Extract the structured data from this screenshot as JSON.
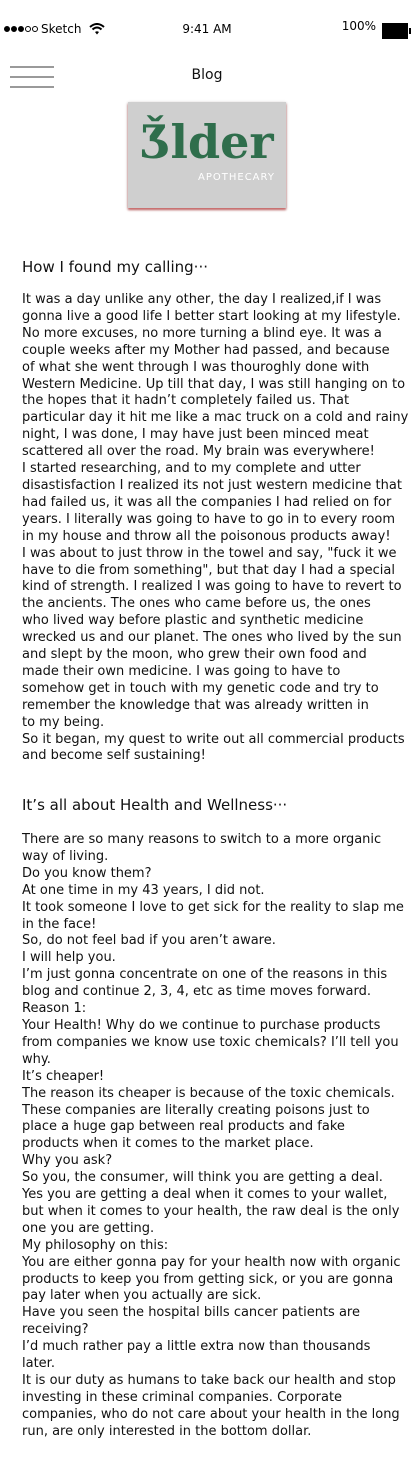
{
  "status_bar": {
    "carrier": "Sketch",
    "time": "9:41 AM",
    "battery": "100%"
  },
  "nav": {
    "title": "Blog"
  },
  "logo": {
    "main": "Ǯlder",
    "sub": "APOTHECARY",
    "color": "#2f6e4c"
  },
  "post": {
    "section1": {
      "heading": "How I found my calling···",
      "lines": [
        "It was a day unlike any other, the day I realized,if I was",
        "gonna live a good life I better start looking at my lifestyle.",
        "No more excuses, no more turning a blind eye. It was a",
        "couple weeks after my Mother had passed, and because",
        "of what she went through I was thouroghly done with",
        "Western Medicine. Up till that day, I was still hanging on to",
        "the hopes that it hadn’t completely failed us. That",
        "particular day it hit me like a mac truck on a cold and rainy",
        "night, I was done, I may have just been minced meat",
        "scattered all over the road. My brain was everywhere!",
        "I started researching, and to my complete and utter",
        "disastisfaction I realized its not just western medicine that",
        "had failed us, it was all the companies I had relied on for",
        "years. I literally was going to have to go in to every room",
        "in my house and throw all the poisonous products away!",
        "I was about to just throw in the towel and say, \"fuck it we",
        "have to die from something\", but that day I had a special",
        "kind of strength. I realized I was going to have to revert to",
        "the ancients. The ones who came before us, the ones",
        "who lived way before plastic and synthetic medicine",
        "wrecked us and our planet. The ones who lived by the sun",
        "and slept by the moon, who grew their own food and",
        "made their own medicine. I was going to have to",
        "somehow get in touch with my genetic code and try to",
        "remember the knowledge that was already written in",
        "to my being.",
        "So it began, my quest to write out all commercial products",
        "and become self sustaining!"
      ]
    },
    "section2": {
      "heading": "It’s all about Health and Wellness···",
      "lines": [
        "There are so many reasons to switch to a more organic",
        "way of living.",
        "Do you know them?",
        "At one time in my 43 years, I did not.",
        "It took someone I love to get sick for the reality to slap me",
        "in the face!",
        "So, do not feel bad if you aren’t aware.",
        "I will help you.",
        "I’m just gonna concentrate on one of the reasons in this",
        "blog and continue 2, 3, 4, etc as time moves forward.",
        "Reason 1:",
        "Your Health! Why do we continue to purchase products",
        "from companies we know use toxic chemicals? I’ll tell you",
        "why.",
        " It’s cheaper!",
        "The reason its cheaper is because of the toxic chemicals.",
        "These companies are literally creating poisons just to",
        "place a huge gap between real products and fake",
        "products when it comes to the market place.",
        " Why you ask?",
        "So you, the consumer, will think you are getting a deal.",
        "Yes you are getting a deal when it comes to your wallet,",
        "but when it comes to your health, the raw deal is the only",
        "one you are getting.",
        "My philosophy on this:",
        "You are either gonna pay for your health now with organic",
        "products to keep you from getting sick, or you are gonna",
        "pay later when you actually are sick.",
        "Have you seen the hospital bills cancer patients are",
        "receiving?",
        "I’d much rather pay a little extra now than thousands",
        "later.",
        "It is our duty as humans to take back our health and stop",
        "investing in these criminal companies. Corporate",
        "companies, who do not care about your health in the long",
        "run, are only interested in the bottom dollar."
      ]
    }
  }
}
